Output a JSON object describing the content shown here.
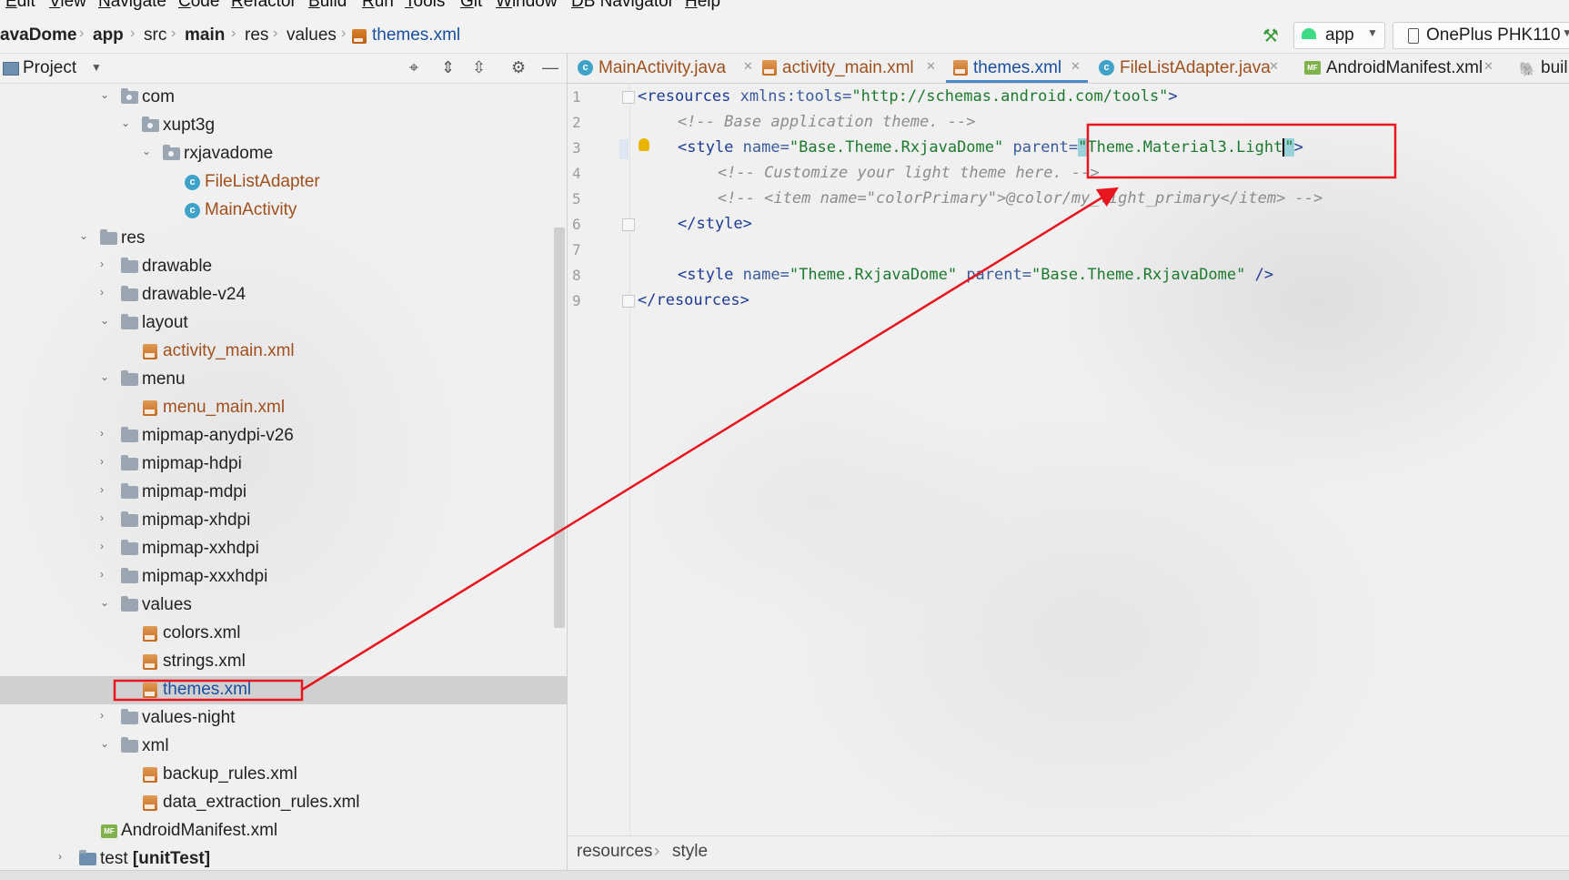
{
  "menu": [
    "Edit",
    "View",
    "Navigate",
    "Code",
    "Refactor",
    "Build",
    "Run",
    "Tools",
    "Git",
    "Window",
    "DB Navigator",
    "Help"
  ],
  "breadcrumb": {
    "project": "avaDome",
    "module": "app",
    "src": "src",
    "main": "main",
    "res": "res",
    "values": "values",
    "file": "themes.xml"
  },
  "toolbar": {
    "build_icon": "hammer-icon",
    "run_config": "app",
    "device": "OnePlus PHK110"
  },
  "project_panel": {
    "title": "Project",
    "tools": [
      "crosshair-icon",
      "expand-all-icon",
      "collapse-all-icon",
      "gear-icon",
      "minimize-icon"
    ]
  },
  "tree": [
    {
      "label": "com",
      "type": "package",
      "expanded": true
    },
    {
      "label": "xupt3g",
      "type": "package",
      "expanded": true
    },
    {
      "label": "rxjavadome",
      "type": "package",
      "expanded": true
    },
    {
      "label": "FileListAdapter",
      "type": "class"
    },
    {
      "label": "MainActivity",
      "type": "class"
    },
    {
      "label": "res",
      "type": "folder",
      "expanded": true
    },
    {
      "label": "drawable",
      "type": "folder",
      "expanded": false
    },
    {
      "label": "drawable-v24",
      "type": "folder",
      "expanded": false
    },
    {
      "label": "layout",
      "type": "folder",
      "expanded": true
    },
    {
      "label": "activity_main.xml",
      "type": "xml-modified"
    },
    {
      "label": "menu",
      "type": "folder",
      "expanded": true
    },
    {
      "label": "menu_main.xml",
      "type": "xml-modified"
    },
    {
      "label": "mipmap-anydpi-v26",
      "type": "folder",
      "expanded": false
    },
    {
      "label": "mipmap-hdpi",
      "type": "folder",
      "expanded": false
    },
    {
      "label": "mipmap-mdpi",
      "type": "folder",
      "expanded": false
    },
    {
      "label": "mipmap-xhdpi",
      "type": "folder",
      "expanded": false
    },
    {
      "label": "mipmap-xxhdpi",
      "type": "folder",
      "expanded": false
    },
    {
      "label": "mipmap-xxxhdpi",
      "type": "folder",
      "expanded": false
    },
    {
      "label": "values",
      "type": "folder",
      "expanded": true
    },
    {
      "label": "colors.xml",
      "type": "xml"
    },
    {
      "label": "strings.xml",
      "type": "xml"
    },
    {
      "label": "themes.xml",
      "type": "xml-selected",
      "selected": true
    },
    {
      "label": "values-night",
      "type": "folder",
      "expanded": false
    },
    {
      "label": "xml",
      "type": "folder",
      "expanded": true
    },
    {
      "label": "backup_rules.xml",
      "type": "xml"
    },
    {
      "label": "data_extraction_rules.xml",
      "type": "xml"
    },
    {
      "label": "AndroidManifest.xml",
      "type": "manifest"
    },
    {
      "label_plain": "test ",
      "label_bold": "[unitTest]",
      "type": "folder",
      "expanded": false
    }
  ],
  "tabs": [
    {
      "label": "MainActivity.java",
      "icon": "class-icon"
    },
    {
      "label": "activity_main.xml",
      "icon": "xml-icon"
    },
    {
      "label": "themes.xml",
      "icon": "xml-icon",
      "active": true
    },
    {
      "label": "FileListAdapter.java",
      "icon": "class-icon"
    },
    {
      "label": "AndroidManifest.xml",
      "icon": "manifest-icon"
    },
    {
      "label": "buil",
      "icon": "gradle-icon"
    }
  ],
  "editor": {
    "line_numbers": [
      "1",
      "2",
      "3",
      "4",
      "5",
      "6",
      "7",
      "8",
      "9"
    ],
    "line1": {
      "open": "<resources",
      "attr": " xmlns:tools=",
      "val": "\"http://schemas.android.com/tools\"",
      "close": ">"
    },
    "line2": {
      "comment": "<!-- Base application theme. -->"
    },
    "line3": {
      "open": "<style",
      "attr1": " name=",
      "val1": "\"Base.Theme.RxjavaDome\"",
      "attr2": " parent=",
      "q1": "\"",
      "val2": "Theme.Material3.Light",
      "q2": "\"",
      "close": ">"
    },
    "line4": {
      "comment": "<!-- Customize your light theme here. -->"
    },
    "line5": {
      "comment": "<!-- <item name=\"colorPrimary\">@color/my_light_primary</item> -->"
    },
    "line6": {
      "tag": "</style>"
    },
    "line8": {
      "open": "<style",
      "attr1": " name=",
      "val1": "\"Theme.RxjavaDome\"",
      "attr2": " parent=",
      "val2": "\"Base.Theme.RxjavaDome\"",
      "close": " />"
    },
    "line9": {
      "tag": "</resources>"
    }
  },
  "status": {
    "crumb1": "resources",
    "crumb2": "style"
  },
  "annotation_color": "#e8141e"
}
